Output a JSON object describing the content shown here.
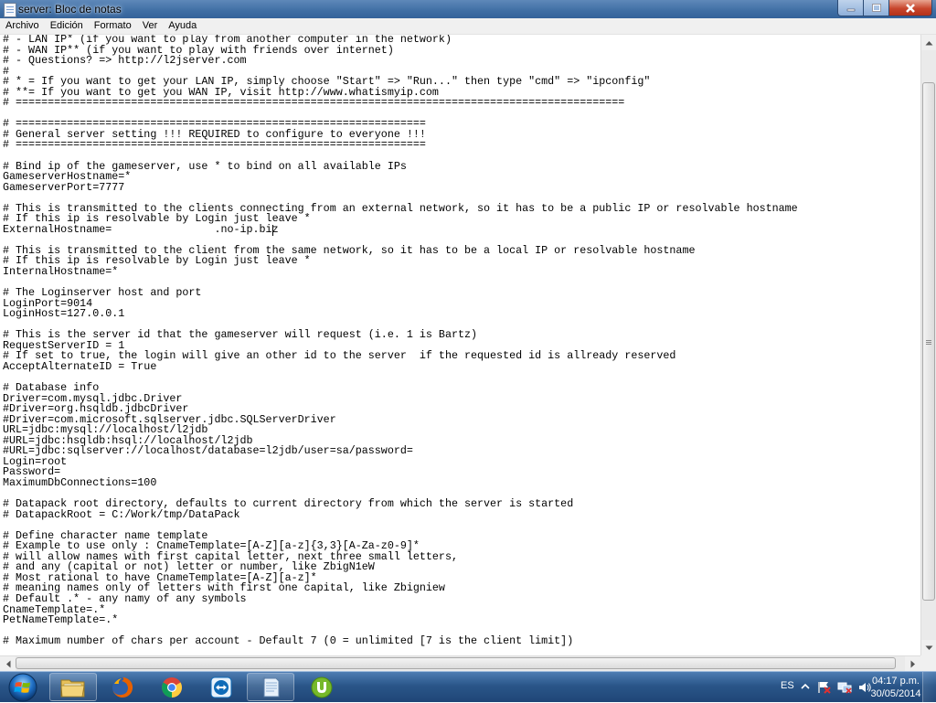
{
  "window": {
    "title": "server: Bloc de notas"
  },
  "menu": {
    "items": [
      "Archivo",
      "Edición",
      "Formato",
      "Ver",
      "Ayuda"
    ]
  },
  "editor": {
    "lines": [
      "# - LAN IP* (if you want to play from another computer in the network)",
      "# - WAN IP** (if you want to play with friends over internet)",
      "# - Questions? => http://l2jserver.com",
      "#",
      "# * = If you want to get your LAN IP, simply choose \"Start\" => \"Run...\" then type \"cmd\" => \"ipconfig\"",
      "# **= If you want to get you WAN IP, visit http://www.whatismyip.com",
      "# ===============================================================================================",
      "",
      "# ================================================================",
      "# General server setting !!! REQUIRED to configure to everyone !!!",
      "# ================================================================",
      "",
      "# Bind ip of the gameserver, use * to bind on all available IPs",
      "GameserverHostname=*",
      "GameserverPort=7777",
      "",
      "# This is transmitted to the clients connecting from an external network, so it has to be a public IP or resolvable hostname",
      "# If this ip is resolvable by Login just leave *",
      "ExternalHostname=                .no-ip.biz",
      "",
      "# This is transmitted to the client from the same network, so it has to be a local IP or resolvable hostname",
      "# If this ip is resolvable by Login just leave *",
      "InternalHostname=*",
      "",
      "# The Loginserver host and port",
      "LoginPort=9014",
      "LoginHost=127.0.0.1",
      "",
      "# This is the server id that the gameserver will request (i.e. 1 is Bartz)",
      "RequestServerID = 1",
      "# If set to true, the login will give an other id to the server  if the requested id is allready reserved",
      "AcceptAlternateID = True",
      "",
      "# Database info",
      "Driver=com.mysql.jdbc.Driver",
      "#Driver=org.hsqldb.jdbcDriver",
      "#Driver=com.microsoft.sqlserver.jdbc.SQLServerDriver",
      "URL=jdbc:mysql://localhost/l2jdb",
      "#URL=jdbc:hsqldb:hsql://localhost/l2jdb",
      "#URL=jdbc:sqlserver://localhost/database=l2jdb/user=sa/password=",
      "Login=root",
      "Password=",
      "MaximumDbConnections=100",
      "",
      "# Datapack root directory, defaults to current directory from which the server is started",
      "# DatapackRoot = C:/Work/tmp/DataPack",
      "",
      "# Define character name template",
      "# Example to use only : CnameTemplate=[A-Z][a-z]{3,3}[A-Za-z0-9]*",
      "# will allow names with first capital letter, next three small letters,",
      "# and any (capital or not) letter or number, like ZbigN1eW",
      "# Most rational to have CnameTemplate=[A-Z][a-z]*",
      "# meaning names only of letters with first one capital, like Zbigniew",
      "# Default .* - any namy of any symbols",
      "CnameTemplate=.*",
      "PetNameTemplate=.*",
      "",
      "# Maximum number of chars per account - Default 7 (0 = unlimited [7 is the client limit])"
    ],
    "caret_line": 18,
    "caret_col": 42
  },
  "scrollbars": {
    "vertical_position": 0.45,
    "vertical_visible": 0.88,
    "horizontal_position": 0,
    "horizontal_visible": 0.99
  },
  "taskbar": {
    "items": [
      {
        "name": "start-button",
        "icon": "windows-orb-icon"
      },
      {
        "name": "explorer",
        "icon": "folder-icon"
      },
      {
        "name": "firefox",
        "icon": "firefox-icon"
      },
      {
        "name": "chrome",
        "icon": "chrome-icon"
      },
      {
        "name": "teamviewer",
        "icon": "teamviewer-icon"
      },
      {
        "name": "notepad",
        "icon": "notepad-icon"
      },
      {
        "name": "utorrent",
        "icon": "utorrent-icon"
      }
    ],
    "language": "ES",
    "clock_time": "04:17 p.m.",
    "clock_date": "30/05/2014"
  },
  "colors": {
    "titlebar": "#3f6ea4",
    "taskbar": "#2a5689",
    "close_button": "#c7452c"
  }
}
